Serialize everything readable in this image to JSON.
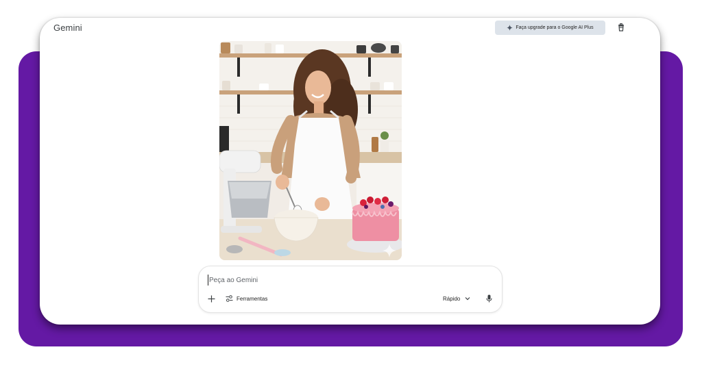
{
  "app": {
    "title": "Gemini"
  },
  "header": {
    "upgrade_label": "Faça upgrade para o Google AI Plus",
    "upgrade_icon": "sparkle-icon",
    "trash_icon": "trash-icon"
  },
  "conversation": {
    "image": {
      "subject": "woman whisking in bowl beside stand mixer and pink strawberry cake"
    }
  },
  "prompt": {
    "placeholder": "Peça ao Gemini",
    "value": "",
    "plus_icon": "plus-icon",
    "tools_label": "Ferramentas",
    "tools_icon": "tools-icon",
    "mode_label": "Rápido",
    "mode_icon": "chevron-down-icon",
    "mic_icon": "mic-icon"
  },
  "colors": {
    "accent_purple": "#6419a4",
    "upgrade_bg": "#dde3ea",
    "text_primary": "#1f1f1f",
    "text_muted": "#5f6368"
  }
}
